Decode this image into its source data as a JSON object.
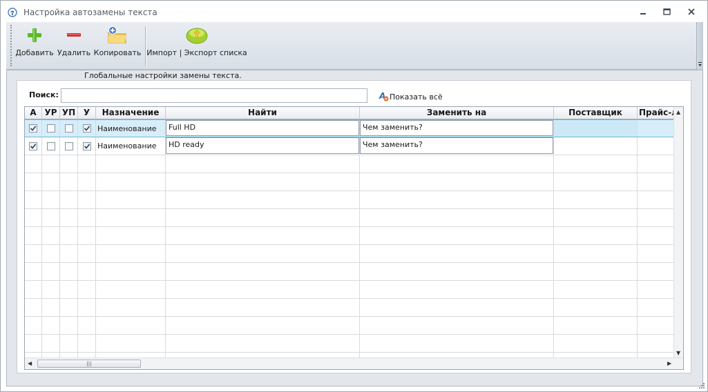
{
  "window": {
    "title": "Настройка автозамены текста",
    "controls": {
      "minimize": "minimize-icon",
      "maximize": "maximize-icon",
      "close": "close-icon"
    }
  },
  "toolbar": {
    "add_label": "Добавить",
    "delete_label": "Удалить",
    "copy_label": "Копировать",
    "import_export_label": "Импорт | Экспорт списка",
    "icons": {
      "add": "plus-icon",
      "delete": "minus-icon",
      "copy": "folder-add-icon",
      "import_export": "arrow-up-circle-icon"
    },
    "colors": {
      "add": "#5cb82e",
      "delete": "#d42a2a",
      "import_export": "#a4cf2e"
    }
  },
  "panel": {
    "caption": "Глобальные настройки замены текста."
  },
  "search": {
    "label": "Поиск:",
    "value": "",
    "placeholder": "",
    "show_all_label": "Показать всё"
  },
  "grid": {
    "columns": [
      "А",
      "УР",
      "УП",
      "У",
      "Назначение",
      "Найти",
      "Заменить на",
      "Поставщик",
      "Прайс-ли"
    ],
    "rows": [
      {
        "a": true,
        "ur": false,
        "up": false,
        "u": true,
        "purpose": "Наименование",
        "find": "Full HD",
        "replace": "Чем заменить?",
        "supplier": "",
        "price": "",
        "selected": true
      },
      {
        "a": true,
        "ur": false,
        "up": false,
        "u": true,
        "purpose": "Наименование",
        "find": "HD ready",
        "replace": "Чем заменить?",
        "supplier": "",
        "price": "",
        "selected": false
      }
    ],
    "selection_color": "#d7eefa"
  }
}
